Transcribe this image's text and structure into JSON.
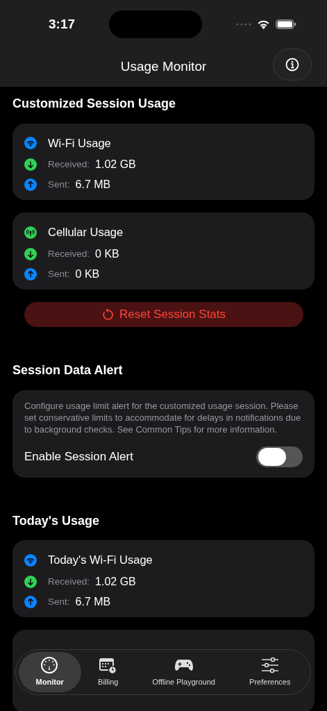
{
  "status_bar": {
    "time": "3:17"
  },
  "nav": {
    "title": "Usage Monitor"
  },
  "blocks": [
    {
      "kind": "heading",
      "text": "Customized Session Usage"
    },
    {
      "kind": "wifi_usage",
      "title": "Wi-Fi Usage",
      "rows": [
        {
          "label": "Received:",
          "value": "1.02 GB"
        },
        {
          "label": "Sent:",
          "value": "6.7 MB"
        }
      ]
    },
    {
      "kind": "cellular_usage",
      "title": "Cellular Usage",
      "rows": [
        {
          "label": "Received:",
          "value": "0 KB"
        },
        {
          "label": "Sent:",
          "value": "0 KB"
        }
      ]
    },
    {
      "kind": "button",
      "label": "Reset Session Stats"
    },
    {
      "kind": "heading",
      "text": "Session Data Alert"
    },
    {
      "kind": "alert_card",
      "note": "Configure usage limit alert for the customized usage session. Please set conservative limits to accommodate for delays in notifications due to background checks. See Common Tips for more information.",
      "toggle_label": "Enable Session Alert",
      "on": false
    },
    {
      "kind": "heading",
      "text": "Today's Usage"
    },
    {
      "kind": "wifi_usage",
      "title": "Today's Wi-Fi Usage",
      "rows": [
        {
          "label": "Received:",
          "value": "1.02 GB"
        },
        {
          "label": "Sent:",
          "value": "6.7 MB"
        }
      ]
    },
    {
      "kind": "hidden_card"
    }
  ],
  "tabs": [
    {
      "label": "Monitor",
      "selected": true
    },
    {
      "label": "Billing",
      "selected": false
    },
    {
      "label": "Offline Playground",
      "selected": false
    },
    {
      "label": "Preferences",
      "selected": false
    }
  ]
}
